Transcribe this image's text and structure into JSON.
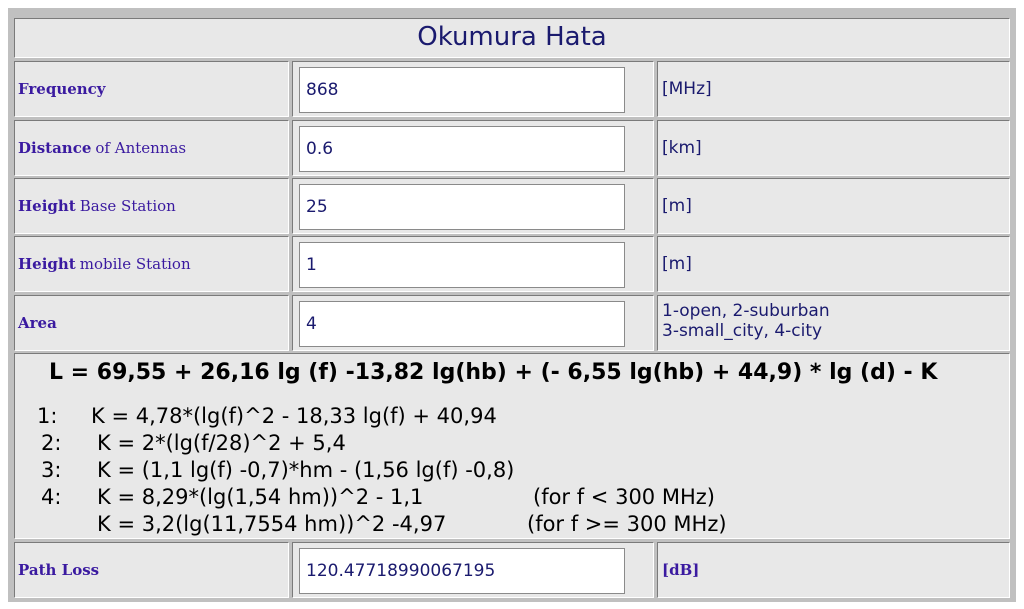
{
  "title": "Okumura Hata",
  "rows": [
    {
      "label_bold": "Frequency",
      "label_rest": "",
      "value": "868",
      "unit": "[MHz]"
    },
    {
      "label_bold": "Distance",
      "label_rest": "of Antennas",
      "value": "0.6",
      "unit": "[km]"
    },
    {
      "label_bold": "Height",
      "label_rest": "Base Station",
      "value": "25",
      "unit": "[m]"
    },
    {
      "label_bold": "Height",
      "label_rest": "mobile Station",
      "value": "1",
      "unit": "[m]"
    },
    {
      "label_bold": "Area",
      "label_rest": "",
      "value": "4",
      "unit_line1": "1-open, 2-suburban",
      "unit_line2": "3-small_city, 4-city"
    }
  ],
  "formula": {
    "main": "L = 69,55 + 26,16 lg (f) -13,82 lg(hb) + (- 6,55 lg(hb) + 44,9) * lg (d) - K",
    "k1_num": "1:",
    "k1": "K = 4,78*(lg(f)^2 - 18,33 lg(f) + 40,94",
    "k2_num": "2:",
    "k2": "K = 2*(lg(f/28)^2 + 5,4",
    "k3_num": "3:",
    "k3": "K = (1,1 lg(f) -0,7)*hm - (1,56 lg(f) -0,8)",
    "k4_num": "4:",
    "k4a": "K = 8,29*(lg(1,54 hm))^2 - 1,1",
    "k4a_cond": "(for f < 300 MHz)",
    "k4b": "K = 3,2(lg(11,7554 hm))^2 -4,97",
    "k4b_cond": "(for f >= 300 MHz)"
  },
  "result": {
    "label": "Path Loss",
    "value": "120.47718990067195",
    "unit": "[dB]"
  }
}
